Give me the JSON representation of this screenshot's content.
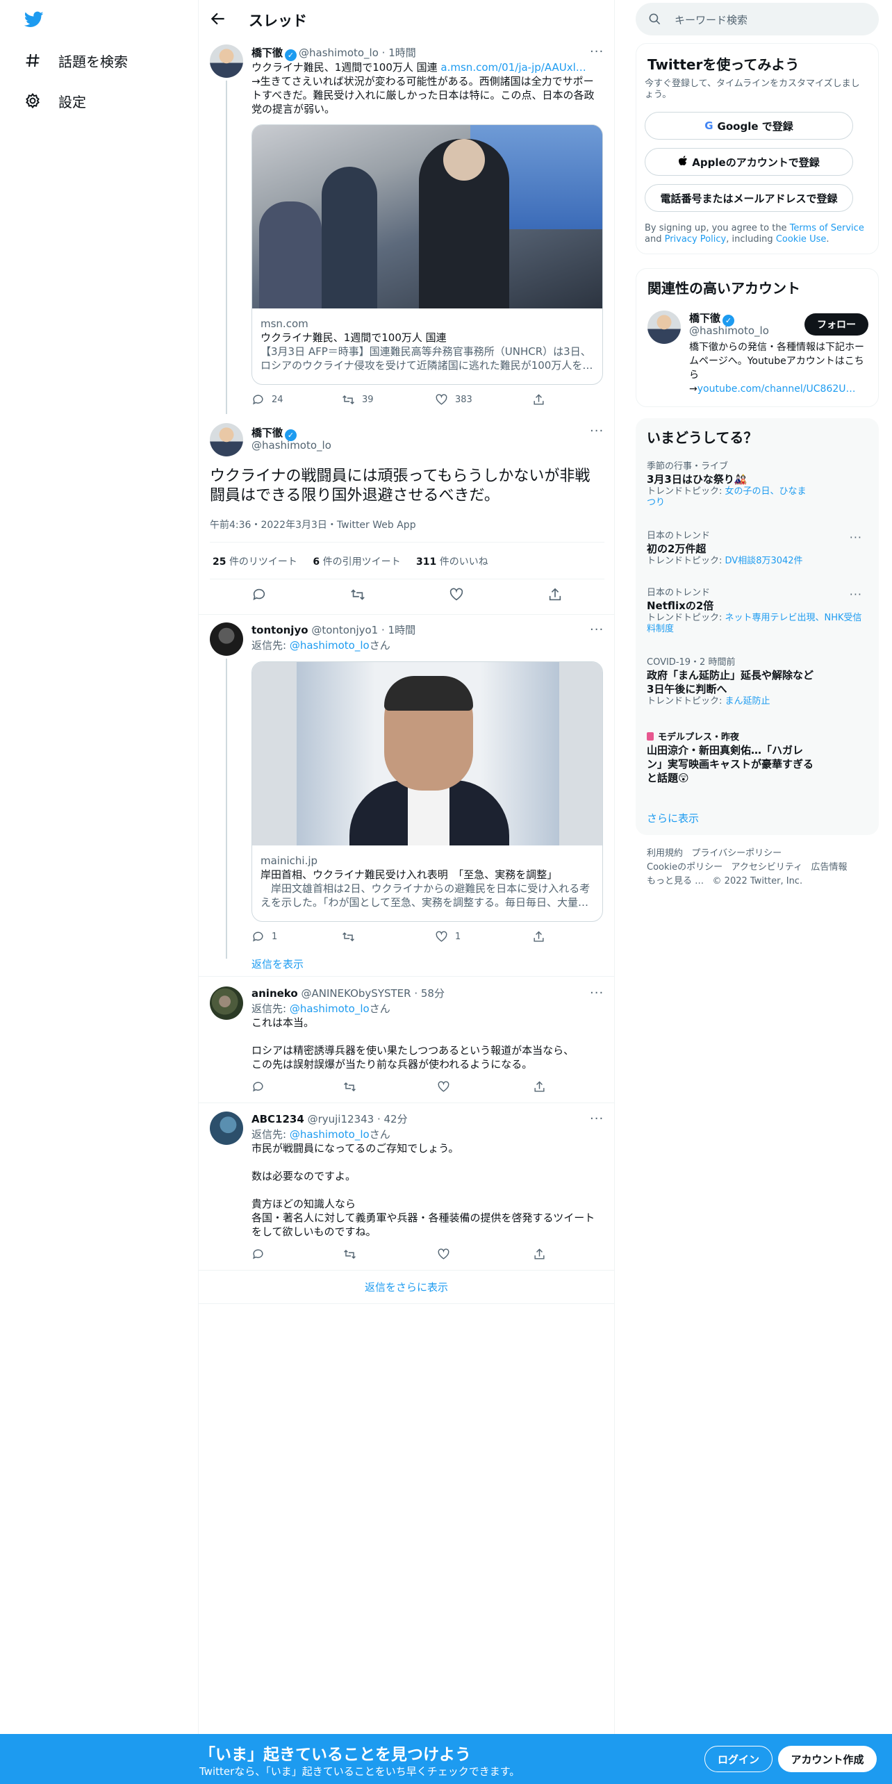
{
  "nav": {
    "items": [
      {
        "label": "話題を検索",
        "icon": "hashtag-icon"
      },
      {
        "label": "設定",
        "icon": "gear-icon"
      }
    ]
  },
  "header": {
    "title": "スレッド"
  },
  "quoted_tweet": {
    "name": "橋下徹",
    "handle": "@hashimoto_lo",
    "time": "1時間",
    "text_prefix": "ウクライナ難民、1週間で100万人 国連 ",
    "link": "a.msn.com/01/ja-jp/AAUxl…",
    "text_body": "→生きてさえいれば状況が変わる可能性がある。西側諸国は全力でサポートすべきだ。難民受け入れに厳しかった日本は特に。この点、日本の各政党の提言が弱い。",
    "card": {
      "domain": "msn.com",
      "title": "ウクライナ難民、1週間で100万人 国連",
      "desc": "【3月3日 AFP＝時事】国連難民高等弁務官事務所（UNHCR）は3日、ロシアのウクライナ侵攻を受けて近隣諸国に逃れた難民が100万人を…"
    },
    "replies": "24",
    "retweets": "39",
    "likes": "383"
  },
  "main_tweet": {
    "name": "橋下徹",
    "handle": "@hashimoto_lo",
    "text": "ウクライナの戦闘員には頑張ってもらうしかないが非戦闘員はできる限り国外退避させるべきだ。",
    "meta": "午前4:36・2022年3月3日・Twitter Web App",
    "retweets_num": "25",
    "retweets_label": "件のリツイート",
    "quotes_num": "6",
    "quotes_label": "件の引用ツイート",
    "likes_num": "311",
    "likes_label": "件のいいね"
  },
  "replies": [
    {
      "name": "tontonjyo",
      "handle": "@tontonjyo1",
      "time": "1時間",
      "reply_to_prefix": "返信先: ",
      "reply_to": "@hashimoto_lo",
      "reply_to_suffix": "さん",
      "card": {
        "domain": "mainichi.jp",
        "title": "岸田首相、ウクライナ難民受け入れ表明　「至急、実務を調整」",
        "desc": "　岸田文雄首相は2日、ウクライナからの避難民を日本に受け入れる考えを示した。「わが国として至急、実務を調整する。毎日毎日、大量…"
      },
      "replies": "1",
      "retweets": "",
      "likes": "1",
      "show_replies": "返信を表示"
    },
    {
      "name": "anineko",
      "handle": "@ANINEKObySYSTER",
      "time": "58分",
      "reply_to_prefix": "返信先: ",
      "reply_to": "@hashimoto_lo",
      "reply_to_suffix": "さん",
      "text": "これは本当。\n\nロシアは精密誘導兵器を使い果たしつつあるという報道が本当なら、\nこの先は誤射誤爆が当たり前な兵器が使われるようになる。"
    },
    {
      "name": "ABC1234",
      "handle": "@ryuji12343",
      "time": "42分",
      "reply_to_prefix": "返信先: ",
      "reply_to": "@hashimoto_lo",
      "reply_to_suffix": "さん",
      "text": "市民が戦闘員になってるのご存知でしょう。\n\n数は必要なのですよ。\n\n貴方ほどの知識人なら\n各国・著名人に対して義勇軍や兵器・各種装備の提供を啓発するツイートをして欲しいものですね。"
    }
  ],
  "more_replies": "返信をさらに表示",
  "search": {
    "placeholder": "キーワード検索"
  },
  "signup_panel": {
    "title": "Twitterを使ってみよう",
    "subtitle": "今すぐ登録して、タイムラインをカスタマイズしましょう。",
    "google": "Google で登録",
    "apple": "Appleのアカウントで登録",
    "phone": "電話番号またはメールアドレスで登録",
    "terms_prefix": "By signing up, you agree to the ",
    "terms": "Terms of Service",
    "and": " and ",
    "privacy": "Privacy Policy",
    "including": ", including ",
    "cookie": "Cookie Use",
    "period": "."
  },
  "related_panel": {
    "title": "関連性の高いアカウント",
    "name": "橋下徹",
    "handle": "@hashimoto_lo",
    "follow": "フォロー",
    "bio": "橋下徹からの発信・各種情報は下記ホームページへ。Youtubeアカウントはこちら\n→",
    "link": "youtube.com/channel/UC862U…"
  },
  "trends_panel": {
    "title": "いまどうしてる？",
    "trends": [
      {
        "context": "季節の行事・ライブ",
        "name": "3月3日はひな祭り🎎",
        "sub_prefix": "トレンドトピック: ",
        "sub": "女の子の日、ひなまつり"
      },
      {
        "context": "日本のトレンド",
        "name": "初の2万件超",
        "sub_prefix": "トレンドトピック: ",
        "sub": "DV相談8万3042件"
      },
      {
        "context": "日本のトレンド",
        "name": "Netflixの2倍",
        "sub_prefix": "トレンドトピック: ",
        "sub": "ネット専用テレビ出現、NHK受信料制度"
      },
      {
        "context": "COVID-19・2 時間前",
        "name": "政府「まん延防止」延長や解除など3日午後に判断へ",
        "sub_prefix": "トレンドトピック: ",
        "sub": "まん延防止"
      },
      {
        "context": "モデルプレス・昨夜",
        "name": "山田涼介・新田真剣佑…「ハガレン」実写映画キャストが豪華すぎると話題😲",
        "sub_prefix": "",
        "sub": ""
      }
    ],
    "show_more": "さらに表示"
  },
  "footer": {
    "links": [
      "利用規約",
      "プライバシーポリシー",
      "Cookieのポリシー",
      "アクセシビリティ",
      "広告情報",
      "もっと見る …"
    ],
    "copyright": "© 2022 Twitter, Inc."
  },
  "bottom_bar": {
    "title": "「いま」起きていることを見つけよう",
    "subtitle": "Twitterなら、「いま」起きていることをいち早くチェックできます。",
    "login": "ログイン",
    "signup": "アカウント作成"
  },
  "colors": {
    "accent": "#1d9bf0",
    "text": "#0f1419",
    "muted": "#536471"
  }
}
